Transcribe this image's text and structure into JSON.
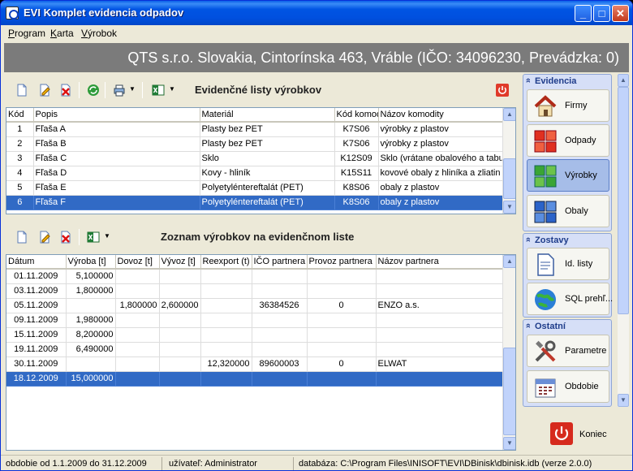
{
  "window": {
    "title": "EVI Komplet evidencia odpadov"
  },
  "menu": [
    {
      "label": "Program",
      "u": "P",
      "rest": "rogram"
    },
    {
      "label": "Karta",
      "u": "K",
      "rest": "arta"
    },
    {
      "label": "Výrobok",
      "u": "V",
      "rest": "ýrobok"
    }
  ],
  "banner": {
    "text": "QTS s.r.o. Slovakia, Cintorínska 463, Vráble (IČO: 34096230, Prevádzka: 0)"
  },
  "top_panel": {
    "caption": "Evidenčné listy výrobkov",
    "columns": [
      "Kód",
      "Popis",
      "Materiál",
      "Kód komod",
      "Názov komodity"
    ],
    "rows": [
      [
        "1",
        "Fľaša A",
        "Plasty bez PET",
        "K7S06",
        "výrobky z plastov"
      ],
      [
        "2",
        "Fľaša B",
        "Plasty bez PET",
        "K7S06",
        "výrobky z plastov"
      ],
      [
        "3",
        "Fľaša C",
        "Sklo",
        "K12S09",
        "Sklo (vrátane obalového a tabu"
      ],
      [
        "4",
        "Fľaša D",
        "Kovy - hliník",
        "K15S11",
        "kovové obaly z hliníka a zliatin"
      ],
      [
        "5",
        "Fľaša E",
        "Polyetyléntereftalát (PET)",
        "K8S06",
        "obaly z plastov"
      ],
      [
        "6",
        "Fľaša F",
        "Polyetyléntereftalát (PET)",
        "K8S06",
        "obaly z plastov"
      ]
    ],
    "selected_row": 5
  },
  "bottom_panel": {
    "caption": "Zoznam výrobkov na evidenčnom liste",
    "columns": [
      "Dátum",
      "Výroba [t]",
      "Dovoz [t]",
      "Vývoz [t]",
      "Reexport (t)",
      "IČO partnera",
      "Provoz partnera",
      "Názov partnera"
    ],
    "rows": [
      [
        "01.11.2009",
        "5,100000",
        "",
        "",
        "",
        "",
        "",
        ""
      ],
      [
        "03.11.2009",
        "1,800000",
        "",
        "",
        "",
        "",
        "",
        ""
      ],
      [
        "05.11.2009",
        "",
        "1,800000",
        "2,600000",
        "",
        "36384526",
        "0",
        "ENZO a.s."
      ],
      [
        "09.11.2009",
        "1,980000",
        "",
        "",
        "",
        "",
        "",
        ""
      ],
      [
        "15.11.2009",
        "8,200000",
        "",
        "",
        "",
        "",
        "",
        ""
      ],
      [
        "19.11.2009",
        "6,490000",
        "",
        "",
        "",
        "",
        "",
        ""
      ],
      [
        "30.11.2009",
        "",
        "",
        "",
        "12,320000",
        "89600003",
        "0",
        "ELWAT"
      ],
      [
        "18.12.2009",
        "15,000000",
        "",
        "",
        "",
        "",
        "",
        ""
      ]
    ],
    "selected_row": 7
  },
  "sidebar": {
    "groups": [
      {
        "title": "Evidencia",
        "items": [
          {
            "label": "Firmy",
            "icon": "house-icon"
          },
          {
            "label": "Odpady",
            "icon": "red-blocks-icon"
          },
          {
            "label": "Výrobky",
            "icon": "green-blocks-icon",
            "active": true
          },
          {
            "label": "Obaly",
            "icon": "blue-blocks-icon"
          }
        ]
      },
      {
        "title": "Zostavy",
        "items": [
          {
            "label": "Id. listy",
            "icon": "document-icon"
          },
          {
            "label": "SQL prehľ...",
            "icon": "globe-icon"
          }
        ]
      },
      {
        "title": "Ostatní",
        "items": [
          {
            "label": "Parametre",
            "icon": "tools-icon"
          },
          {
            "label": "Obdobie",
            "icon": "calendar-icon"
          }
        ]
      }
    ],
    "exit_label": "Koniec"
  },
  "status": {
    "period": "obdobie od 1.1.2009 do 31.12.2009",
    "user": "užívateľ: Administrator",
    "database": "databáza: C:\\Program Files\\INISOFT\\EVI\\DBinisk\\dbinisk.idb (verze 2.0.0)"
  },
  "colors": {
    "selection": "#316ac5",
    "banner": "#7b7b7b",
    "titlebar": "#0054e3"
  }
}
